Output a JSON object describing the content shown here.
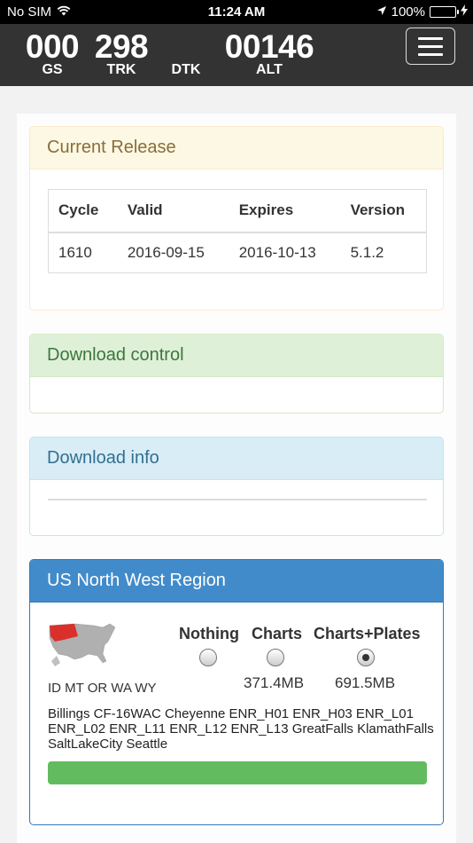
{
  "status_bar": {
    "carrier": "No SIM",
    "time": "11:24 AM",
    "battery_pct": "100%",
    "icons": [
      "wifi-icon",
      "location-arrow-icon",
      "battery-icon",
      "charging-bolt-icon"
    ]
  },
  "nav": {
    "instruments": [
      {
        "value": "000",
        "label": "GS"
      },
      {
        "value": "298",
        "label": "TRK"
      },
      {
        "value": "",
        "label": "DTK"
      },
      {
        "value": "00146",
        "label": "ALT"
      }
    ],
    "menu_icon": "hamburger-menu-icon"
  },
  "current_release": {
    "title": "Current Release",
    "columns": [
      "Cycle",
      "Valid",
      "Expires",
      "Version"
    ],
    "rows": [
      [
        "1610",
        "2016-09-15",
        "2016-10-13",
        "5.1.2"
      ]
    ]
  },
  "download_control": {
    "title": "Download control"
  },
  "download_info": {
    "title": "Download info",
    "progress": 0
  },
  "region": {
    "title": "US North West Region",
    "states": "ID MT OR WA WY",
    "options": [
      {
        "label": "Nothing",
        "size": "",
        "checked": false
      },
      {
        "label": "Charts",
        "size": "371.4MB",
        "checked": false
      },
      {
        "label": "Charts+Plates",
        "size": "691.5MB",
        "checked": true
      }
    ],
    "charts": "Billings CF-16WAC Cheyenne ENR_H01 ENR_H03 ENR_L01 ENR_L02 ENR_L11 ENR_L12 ENR_L13 GreatFalls KlamathFalls SaltLakeCity Seattle",
    "progress": 1.0
  },
  "colors": {
    "warning_text": "#8a6d3b",
    "success_text": "#3c763d",
    "info_text": "#31708f",
    "primary_bg": "#428bca",
    "progress_fill": "#62bc5f"
  }
}
